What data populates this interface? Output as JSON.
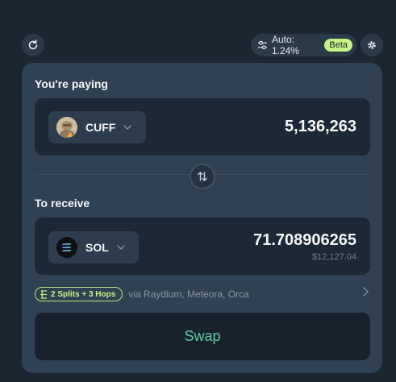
{
  "header": {
    "slippage_label": "Auto: 1.24%",
    "beta_badge": "Beta"
  },
  "paying": {
    "label": "You're paying",
    "token": "CUFF",
    "amount": "5,136,263"
  },
  "receive": {
    "label": "To receive",
    "token": "SOL",
    "amount": "71.708906265",
    "usd_value": "$12,127.04"
  },
  "route": {
    "summary": "2 Splits + 3 Hops",
    "via": "via Raydium, Meteora, Orca"
  },
  "swap_button": "Swap",
  "colors": {
    "background": "#1c2630",
    "card": "#304153",
    "input_box": "#1c2835",
    "accent_green": "#c7f284",
    "swap_text": "#5ec9a2"
  }
}
